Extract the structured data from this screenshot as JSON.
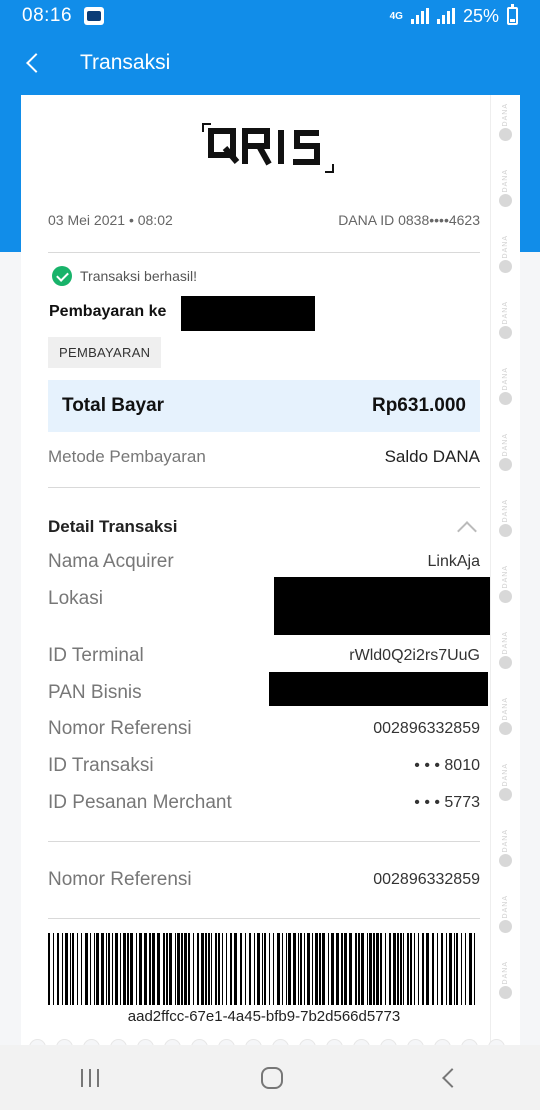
{
  "status": {
    "time": "08:16",
    "network": "4G",
    "battery": "25%"
  },
  "header": {
    "title": "Transaksi"
  },
  "receipt": {
    "logo_text": "QRIS",
    "date": "03 Mei 2021 • 08:02",
    "dana_id": "DANA ID 0838••••4623",
    "stripe_text": "DANA",
    "success_text": "Transaksi berhasil!",
    "pay_to_label": "Pembayaran ke",
    "type_chip": "PEMBAYARAN",
    "total_label": "Total Bayar",
    "total_value": "Rp631.000",
    "method_label": "Metode Pembayaran",
    "method_value": "Saldo DANA",
    "detail_title": "Detail Transaksi",
    "details": [
      {
        "label": "Nama Acquirer",
        "value": "LinkAja"
      },
      {
        "label": "Lokasi",
        "value": ""
      },
      {
        "label": "ID Terminal",
        "value": "rWld0Q2i2rs7UuG"
      },
      {
        "label": "PAN Bisnis",
        "value": ""
      },
      {
        "label": "Nomor Referensi",
        "value": "002896332859"
      },
      {
        "label": "ID Transaksi",
        "value": "• • • 8010"
      },
      {
        "label": "ID Pesanan Merchant",
        "value": "• • • 5773"
      }
    ],
    "reference_label": "Nomor Referensi",
    "reference_value": "002896332859",
    "barcode_text": "aad2ffcc-67e1-4a45-bfb9-7b2d566d5773"
  },
  "colors": {
    "brand": "#118de9",
    "success": "#18b36a",
    "total_bg": "#e6f2fd"
  }
}
